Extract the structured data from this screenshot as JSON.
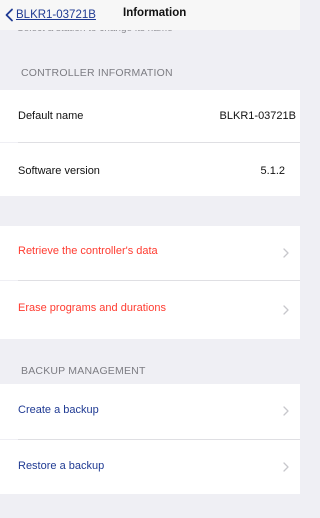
{
  "navbar": {
    "back_label": "BLKR1-03721B",
    "title": "Information"
  },
  "hint": "Select a station to change its name",
  "controller_info": {
    "header": "CONTROLLER INFORMATION",
    "rows": [
      {
        "label": "Default name",
        "value": "BLKR1-03721B"
      },
      {
        "label": "Software version",
        "value": "5.1.2"
      }
    ]
  },
  "data_actions": {
    "rows": [
      {
        "label": "Retrieve the controller's data"
      },
      {
        "label": "Erase programs and durations"
      }
    ]
  },
  "backup": {
    "header": "BACKUP MANAGEMENT",
    "rows": [
      {
        "label": "Create a backup"
      },
      {
        "label": "Restore a backup"
      }
    ]
  },
  "colors": {
    "tint": "#1f3a93",
    "destructive": "#ff3b30",
    "background": "#efeff4"
  },
  "icons": {
    "back": "chevron-left-icon",
    "disclosure": "chevron-right-icon"
  }
}
